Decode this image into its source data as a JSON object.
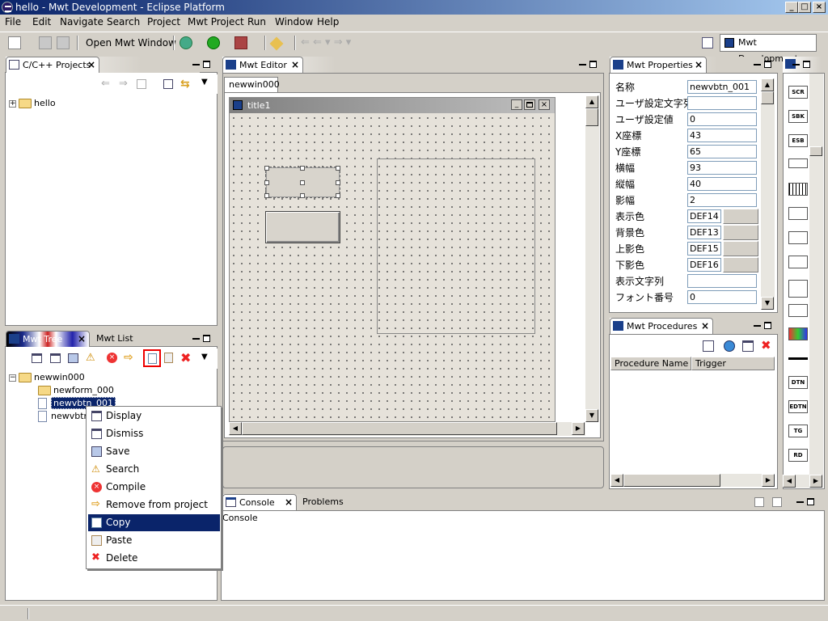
{
  "window": {
    "title": "hello - Mwt Development - Eclipse Platform",
    "minimize": "_",
    "maximize": "□",
    "close": "×"
  },
  "menu": [
    "File",
    "Edit",
    "Navigate",
    "Search",
    "Project",
    "Mwt Project",
    "Run",
    "Window",
    "Help"
  ],
  "toolbar": {
    "open_window": "Open Mwt Window",
    "perspective": "Mwt Development"
  },
  "projects_view": {
    "tab": "C/C++ Projects",
    "tree_root": "hello"
  },
  "mwt_tree": {
    "tab": "Mwt Tree",
    "tab2": "Mwt List",
    "items": [
      {
        "label": "newwin000"
      },
      {
        "label": "newform_000"
      },
      {
        "label": "newvbtn_001"
      },
      {
        "label": "newvbtn"
      }
    ]
  },
  "editor": {
    "tab": "Mwt Editor",
    "doc_tab": "newwin000",
    "form_title": "title1"
  },
  "properties": {
    "tab": "Mwt Properties",
    "rows": [
      {
        "label": "名称",
        "value": "newvbtn_001"
      },
      {
        "label": "ユーザ設定文字列",
        "value": ""
      },
      {
        "label": "ユーザ設定値",
        "value": "0"
      },
      {
        "label": "X座標",
        "value": "43"
      },
      {
        "label": "Y座標",
        "value": "65"
      },
      {
        "label": "横幅",
        "value": "93"
      },
      {
        "label": "縦幅",
        "value": "40"
      },
      {
        "label": "影幅",
        "value": "2"
      },
      {
        "label": "表示色",
        "value": "DEF14"
      },
      {
        "label": "背景色",
        "value": "DEF13"
      },
      {
        "label": "上影色",
        "value": "DEF15"
      },
      {
        "label": "下影色",
        "value": "DEF16"
      },
      {
        "label": "表示文字列",
        "value": ""
      },
      {
        "label": "フォント番号",
        "value": "0"
      }
    ]
  },
  "procedures": {
    "tab": "Mwt Procedures",
    "col1": "Procedure Name",
    "col2": "Trigger"
  },
  "console": {
    "tab": "Console",
    "tab2": "Problems",
    "label": "Console"
  },
  "context_menu": [
    {
      "label": "Display",
      "icon": "window-icon"
    },
    {
      "label": "Dismiss",
      "icon": "window-icon"
    },
    {
      "label": "Save",
      "icon": "save-icon"
    },
    {
      "label": "Search",
      "icon": "warning-icon"
    },
    {
      "label": "Compile",
      "icon": "error-icon"
    },
    {
      "label": "Remove from project",
      "icon": "arrow-icon"
    },
    {
      "label": "Copy",
      "icon": "copy-icon",
      "selected": true
    },
    {
      "label": "Paste",
      "icon": "paste-icon"
    },
    {
      "label": "Delete",
      "icon": "delete-icon"
    }
  ],
  "palette": [
    "SCR",
    "SBK",
    "ESB",
    "",
    "",
    "",
    "",
    "",
    "",
    "",
    "",
    "",
    "DTN",
    "EDTN",
    "TG",
    "RD"
  ]
}
